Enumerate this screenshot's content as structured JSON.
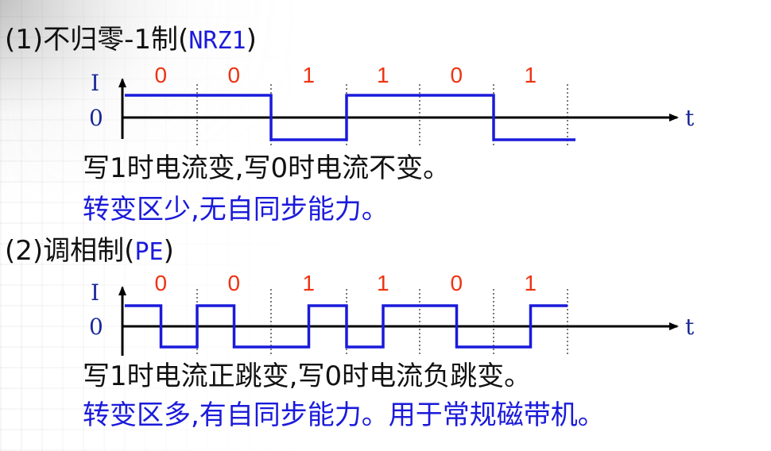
{
  "sections": [
    {
      "heading_prefix": "(1)不归零-1制(",
      "heading_code": "NRZ1",
      "heading_suffix": ")",
      "axis_y_label": "I",
      "axis_zero_label": "0",
      "axis_x_label": "t",
      "bits": [
        "0",
        "0",
        "1",
        "1",
        "0",
        "1"
      ],
      "waveform_levels": [
        1,
        1,
        -1,
        1,
        1,
        -1
      ],
      "line1": "写1时电流变,写0时电流不变。",
      "line2": "转变区少,无自同步能力。"
    },
    {
      "heading_prefix": "(2)调相制(",
      "heading_code": "PE",
      "heading_suffix": ")",
      "axis_y_label": "I",
      "axis_zero_label": "0",
      "axis_x_label": "t",
      "bits": [
        "0",
        "0",
        "1",
        "1",
        "0",
        "1"
      ],
      "waveform_levels": [
        1,
        -1,
        1,
        -1,
        -1,
        1,
        -1,
        1,
        1,
        -1,
        -1,
        1
      ],
      "line1": "写1时电流正跳变,写0时电流负跳变。",
      "line2": "转变区多,有自同步能力。用于常规磁带机。"
    }
  ],
  "colors": {
    "waveform": "#1a1adb",
    "bits": "#ee3311",
    "axis": "#000000",
    "text_blue": "#1a1adb"
  }
}
